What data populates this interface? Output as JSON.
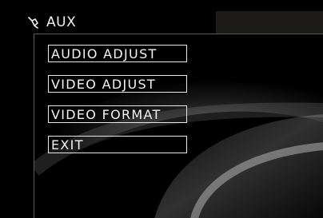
{
  "header": {
    "source_label": "AUX",
    "source_icon": "aux-plug-icon"
  },
  "menu": {
    "items": [
      {
        "label": "AUDIO ADJUST"
      },
      {
        "label": "VIDEO ADJUST"
      },
      {
        "label": "VIDEO FORMAT"
      },
      {
        "label": "EXIT"
      }
    ]
  },
  "colors": {
    "background": "#000000",
    "text": "#ffffff",
    "item_border": "#e8e8e8",
    "topbar_block": "#1d1b18"
  }
}
